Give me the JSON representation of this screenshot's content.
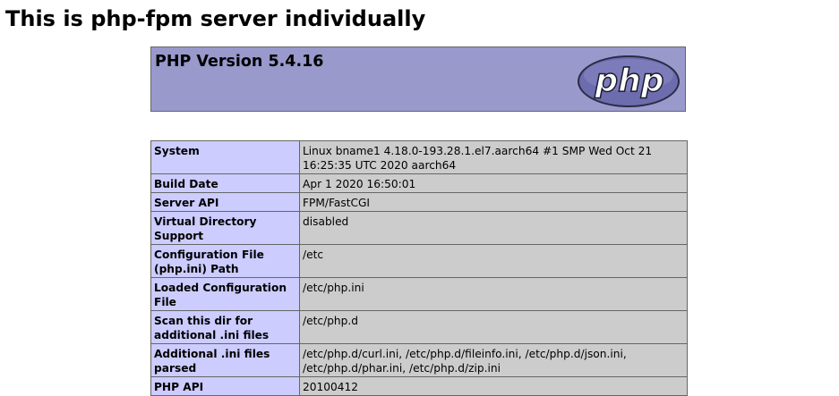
{
  "page": {
    "heading": "This is php-fpm server individually"
  },
  "header": {
    "version_title": "PHP Version 5.4.16",
    "logo_text": "php"
  },
  "colors": {
    "header_bg": "#9999cc",
    "label_cell_bg": "#ccccff",
    "value_cell_bg": "#cccccc",
    "border": "#666666",
    "logo_fill": "#6c6cae",
    "logo_dark": "#2b2b45"
  },
  "info_table": {
    "rows": [
      {
        "label": "System",
        "value": "Linux bname1 4.18.0-193.28.1.el7.aarch64 #1 SMP Wed Oct 21 16:25:35 UTC 2020 aarch64"
      },
      {
        "label": "Build Date",
        "value": "Apr 1 2020 16:50:01"
      },
      {
        "label": "Server API",
        "value": "FPM/FastCGI"
      },
      {
        "label": "Virtual Directory Support",
        "value": "disabled"
      },
      {
        "label": "Configuration File (php.ini) Path",
        "value": "/etc"
      },
      {
        "label": "Loaded Configuration File",
        "value": "/etc/php.ini"
      },
      {
        "label": "Scan this dir for additional .ini files",
        "value": "/etc/php.d"
      },
      {
        "label": "Additional .ini files parsed",
        "value": "/etc/php.d/curl.ini, /etc/php.d/fileinfo.ini, /etc/php.d/json.ini, /etc/php.d/phar.ini, /etc/php.d/zip.ini"
      },
      {
        "label": "PHP API",
        "value": "20100412"
      }
    ]
  }
}
